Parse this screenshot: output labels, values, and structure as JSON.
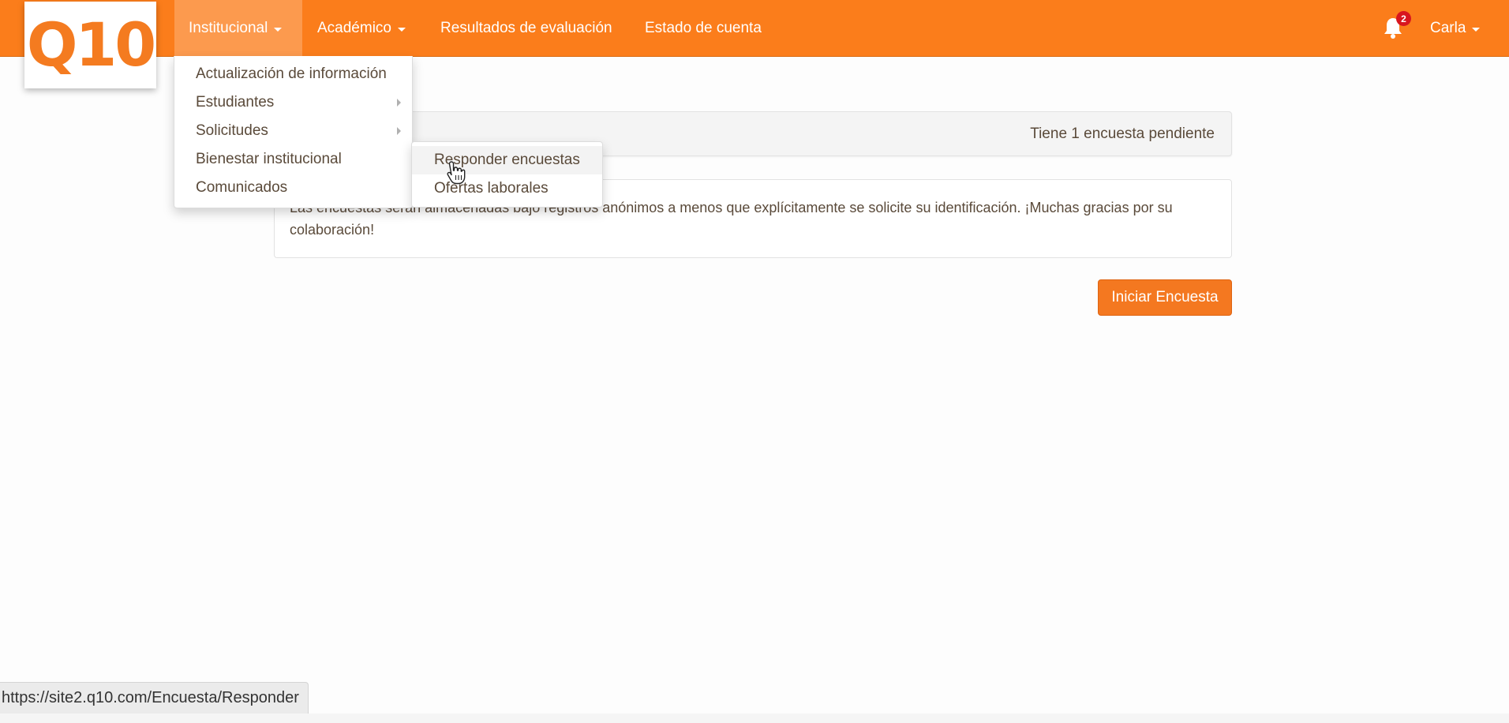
{
  "app": {
    "logo_text": "Q10"
  },
  "navbar": {
    "items": [
      {
        "label": "Institucional"
      },
      {
        "label": "Académico"
      },
      {
        "label": "Resultados de evaluación"
      },
      {
        "label": "Estado de cuenta"
      }
    ],
    "notifications_count": "2",
    "user_name": "Carla"
  },
  "dropdown": {
    "items": [
      {
        "label": "Actualización de información"
      },
      {
        "label": "Estudiantes"
      },
      {
        "label": "Solicitudes"
      },
      {
        "label": "Bienestar institucional"
      },
      {
        "label": "Comunicados"
      }
    ]
  },
  "submenu": {
    "items": [
      {
        "label": "Responder encuestas"
      },
      {
        "label": "Ofertas laborales"
      }
    ]
  },
  "main": {
    "pending_text": "Tiene 1 encuesta pendiente",
    "info_text": "Las encuestas serán almacenadas bajo registros anónimos a menos que explícitamente se solicite su identificación. ¡Muchas gracias por su colaboración!",
    "start_button": "Iniciar Encuesta"
  },
  "status_bar": {
    "url": "https://site2.q10.com/Encuesta/Responder"
  },
  "colors": {
    "brand": "#fb7d1b",
    "button": "#f47820",
    "badge": "#d8161f"
  },
  "icons": {
    "notification": "bell-icon",
    "submenu_indicator": "chevron-right-icon",
    "dropdown_indicator": "caret-down-icon",
    "pointer": "hand-cursor-icon"
  }
}
